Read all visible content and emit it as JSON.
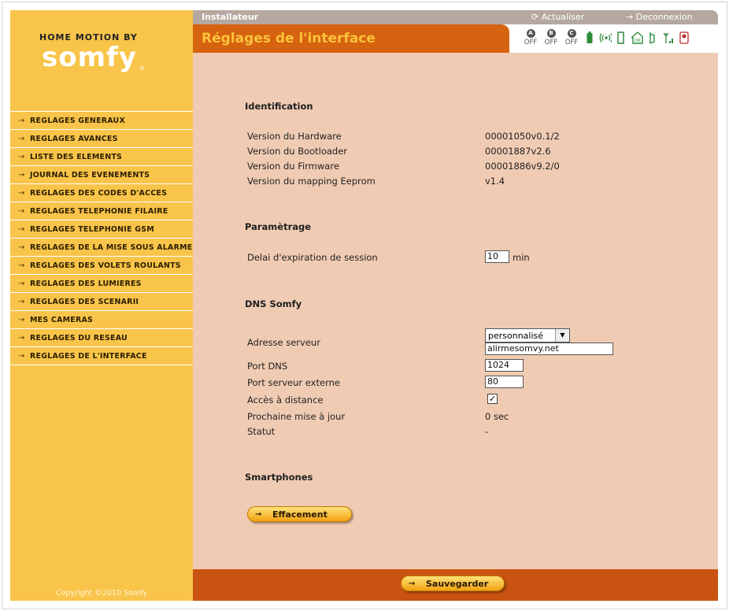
{
  "brand": {
    "by_line": "HOME MOTION BY",
    "name": "somfy",
    "reg": "®"
  },
  "header": {
    "section": "Installateur",
    "refresh_label": "Actualiser",
    "logout_label": "Deconnexion",
    "page_title": "Réglages de l'interface"
  },
  "status": {
    "zones": [
      {
        "letter": "A",
        "state": "OFF"
      },
      {
        "letter": "B",
        "state": "OFF"
      },
      {
        "letter": "C",
        "state": "OFF"
      }
    ],
    "colors": {
      "battery": "#2e8b3a",
      "indicator": "#2e8b3a",
      "alert": "#c0282d"
    }
  },
  "sidebar": {
    "items": [
      {
        "label": "REGLAGES GENERAUX"
      },
      {
        "label": "REGLAGES AVANCES"
      },
      {
        "label": "LISTE DES ELEMENTS"
      },
      {
        "label": "JOURNAL DES EVENEMENTS"
      },
      {
        "label": "REGLAGES DES CODES D'ACCES"
      },
      {
        "label": "REGLAGES TELEPHONIE FILAIRE"
      },
      {
        "label": "REGLAGES TELEPHONIE GSM"
      },
      {
        "label": "REGLAGES DE LA MISE SOUS ALARME"
      },
      {
        "label": "REGLAGES DES VOLETS ROULANTS"
      },
      {
        "label": "REGLAGES DES LUMIERES"
      },
      {
        "label": "REGLAGES DES SCENARII"
      },
      {
        "label": "MES CAMERAS"
      },
      {
        "label": "REGLAGES DU RESEAU"
      },
      {
        "label": "REGLAGES DE L'INTERFACE"
      }
    ],
    "copyright": "Copyright ©2010 Somfy"
  },
  "identification": {
    "title": "Identification",
    "rows": [
      {
        "label": "Version du Hardware",
        "value": "00001050v0.1/2"
      },
      {
        "label": "Version du Bootloader",
        "value": "00001887v2.6"
      },
      {
        "label": "Version du Firmware",
        "value": "00001886v9.2/0"
      },
      {
        "label": "Version du mapping Eeprom",
        "value": "v1.4"
      }
    ]
  },
  "parametrage": {
    "title": "Paramètrage",
    "session_label": "Delai d'expiration de session",
    "session_value": "10",
    "session_unit": "min"
  },
  "dns": {
    "title": "DNS Somfy",
    "server_label": "Adresse serveur",
    "server_mode": "personnalisé",
    "server_address": "alirmesomvy.net",
    "port_dns_label": "Port DNS",
    "port_dns_value": "1024",
    "port_ext_label": "Port serveur externe",
    "port_ext_value": "80",
    "remote_label": "Accès à distance",
    "remote_checked": "✓",
    "next_update_label": "Prochaine mise à jour",
    "next_update_value": "0 sec",
    "status_label": "Statut",
    "status_value": "-"
  },
  "smartphones": {
    "title": "Smartphones",
    "clear_label": "Effacement"
  },
  "footer": {
    "save_label": "Sauvegarder"
  }
}
